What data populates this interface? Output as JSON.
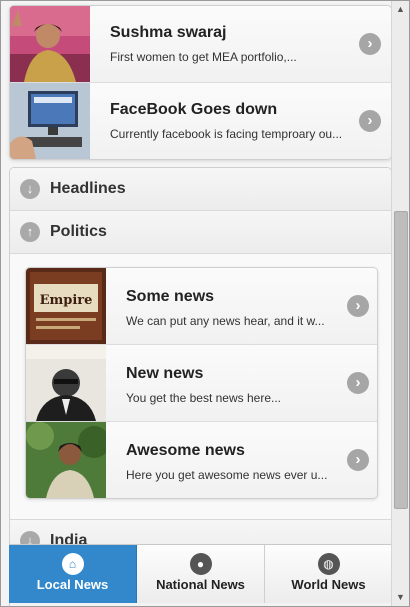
{
  "top_list": [
    {
      "title": "Sushma swaraj",
      "subtitle": "First women to get MEA portfolio,..."
    },
    {
      "title": "FaceBook Goes down",
      "subtitle": "Currently facebook is facing temproary ou..."
    }
  ],
  "sections": [
    {
      "label": "Headlines",
      "icon": "arrow-down-icon",
      "state": "collapsed"
    },
    {
      "label": "Politics",
      "icon": "arrow-up-icon",
      "state": "expanded"
    },
    {
      "label": "India",
      "icon": "arrow-down-icon",
      "state": "collapsed"
    }
  ],
  "politics_items": [
    {
      "title": "Some news",
      "subtitle": "We can put any news hear, and it w...",
      "thumb_text": "Empire"
    },
    {
      "title": "New news",
      "subtitle": "You get the best news here..."
    },
    {
      "title": "Awesome news",
      "subtitle": "Here you get awesome news ever u..."
    }
  ],
  "nav": [
    {
      "label": "Local News",
      "icon": "home-icon",
      "active": true
    },
    {
      "label": "National News",
      "icon": "group-icon",
      "active": false
    },
    {
      "label": "World News",
      "icon": "globe-icon",
      "active": false
    }
  ],
  "colors": {
    "accent": "#3388cc",
    "icon_gray": "#a6a6a6"
  }
}
